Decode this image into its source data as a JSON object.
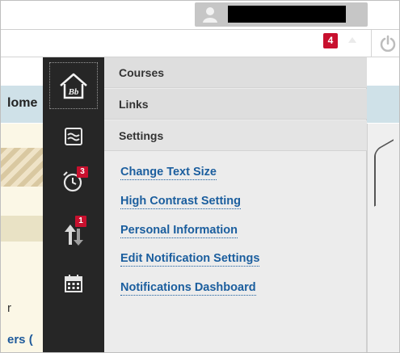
{
  "header": {
    "notification_count": "4"
  },
  "background": {
    "home_text": "lome",
    "text_r": "r",
    "text_ers": "ers ("
  },
  "rail": {
    "logo_text": "Bb",
    "alarm_badge": "3",
    "updates_badge": "1"
  },
  "menu": {
    "tabs": [
      {
        "label": "Courses"
      },
      {
        "label": "Links"
      },
      {
        "label": "Settings"
      }
    ],
    "links": [
      {
        "label": "Change Text Size"
      },
      {
        "label": "High Contrast Setting"
      },
      {
        "label": "Personal Information"
      },
      {
        "label": "Edit Notification Settings"
      },
      {
        "label": "Notifications Dashboard"
      }
    ]
  },
  "colors": {
    "rail_bg": "#262626",
    "badge_red": "#c8102e",
    "link_blue": "#1b5e9e"
  }
}
